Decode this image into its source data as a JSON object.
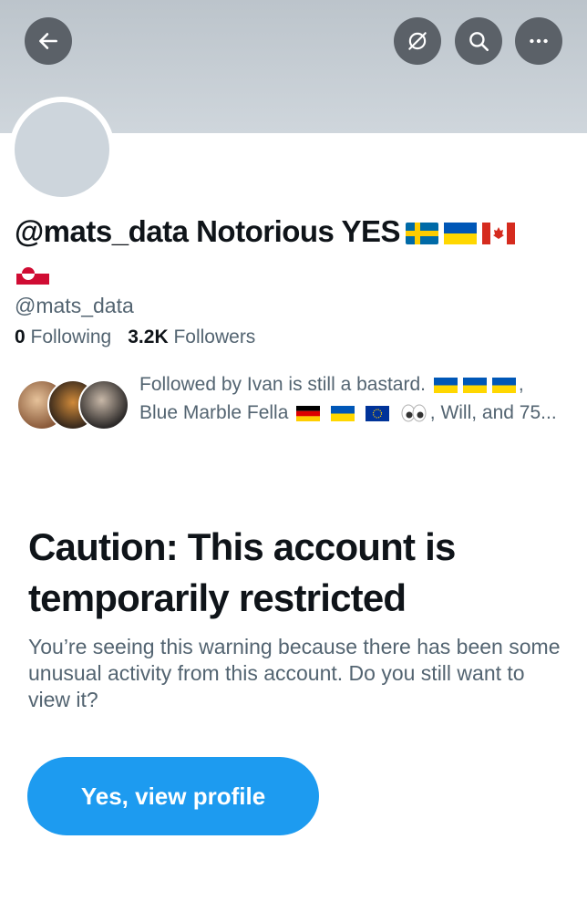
{
  "profile": {
    "display_name": "@mats_data Notorious YES",
    "handle": "@mats_data",
    "following_count": "0",
    "following_label": "Following",
    "followers_count": "3.2K",
    "followers_label": "Followers",
    "name_flags": [
      "flag-sweden-icon",
      "flag-ukraine-icon",
      "flag-canada-icon",
      "flag-greenland-icon"
    ]
  },
  "header": {
    "back_icon": "arrow-left-icon",
    "translate_icon": "translate-icon",
    "search_icon": "search-icon",
    "more_icon": "more-horizontal-icon"
  },
  "followed_by": {
    "prefix": "Followed by Ivan is still a bastard.",
    "sep1": ",",
    "name2": "Blue Marble Fella",
    "suffix": ", Will, and 75..."
  },
  "caution": {
    "title": "Caution: This account is temporarily restricted",
    "body": "You’re seeing this warning because there has been some unusual activity from this account. Do you still want to view it?",
    "button_label": "Yes, view profile"
  },
  "colors": {
    "accent": "#1d9bf0",
    "banner": "#c7cfd6",
    "secondary_text": "#536471"
  }
}
